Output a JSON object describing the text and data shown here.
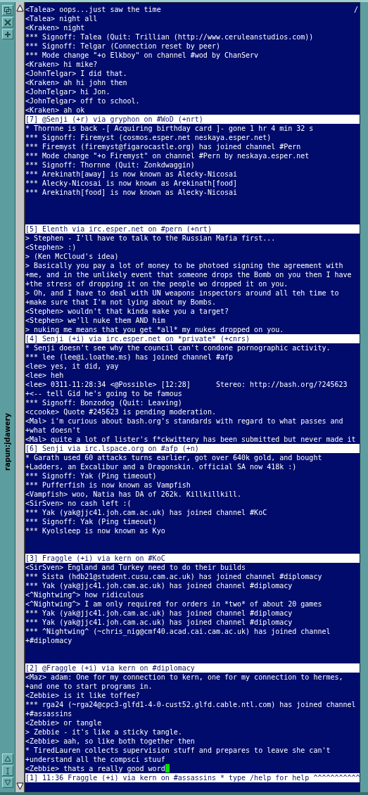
{
  "window": {
    "title": "rapun:jdawery",
    "corner_mark": "/"
  },
  "panes": [
    {
      "lines": [
        "<Talea> oops...just saw the time",
        "<Talea> night all",
        "<Kraken> night",
        "*** Signoff: Talea (Quit: Trillian (http://www.ceruleanstudios.com))",
        "*** Signoff: Telgar (Connection reset by peer)",
        "*** Mode change \"+o Elkboy\" on channel #wod by ChanServ",
        "<Kraken> hi mike?",
        "<JohnTelgar> I did that.",
        "<Kraken> ah hi john then",
        "<JohnTelgar> hi Jon.",
        "<JohnTelgar> off to school.",
        "<Kraken> ah ok"
      ],
      "status": "[7] @Senji (+r) via gryphon on #WoD (+nrt)"
    },
    {
      "lines": [
        "* Thornne is back -[ Acquiring birthday card ]- gone 1 hr 4 min 32 s",
        "*** Signoff: Firemyst (cosmos.esper.net neskaya.esper.net)",
        "*** Firemyst (firemyst@figarocastle.org) has joined channel #Pern",
        "*** Mode change \"+o Firemyst\" on channel #Pern by neskaya.esper.net",
        "*** Signoff: Thornne (Quit: Zonkdwaggin)",
        "*** Arekinath[away] is now known as Alecky-Nicosai",
        "*** Alecky-Nicosai is now known as Arekinath[food]",
        "*** Arekinath[food] is now known as Alecky-Nicosai"
      ],
      "status": "[5] Elenth via irc.esper.net on #pern (+nrt)"
    },
    {
      "lines": [
        "> Stephen - I'll have to talk to the Russian Mafia first...",
        "<Stephen> :)",
        "> (Ken McCloud's idea)",
        "> Basically you pay a lot of money to be photoed signing the agreement with",
        "+me, and in the unlikely event that someone drops the Bomb on you then I have",
        "+the stress of dropping it on the people wo dropped it on you.",
        "> Oh, and I have to deal with UN weapons inspectors around all teh time to",
        "+make sure that I'm not lying about my Bombs.",
        "<Stephen> wouldn't that kinda make you a target?",
        "<Stephen> we'll nuke them AND him",
        "> nuking me means that you get *all* my nukes dropped on you."
      ],
      "status": "[4] Senji (+i) via irc.esper.net on *private* (+cnrs)"
    },
    {
      "lines": [
        "* Senji doesn't see why the council can't condone pornographic activity.",
        "*** lee (lee@i.loathe.ms) has joined channel #afp",
        "<lee> yes, it did, yay",
        "<lee> heh",
        "<lee> 0311-11:28:34 <@Possible> [12:28]      Stereo: http://bash.org/?245623",
        "+<-- tell Gid he's going to be famous",
        "*** Signoff: Bonzodog (Quit: Leaving)",
        "<ccooke> Quote #245623 is pending moderation.",
        "<Mal> i'm curious about bash.org's standards with regard to what passes and",
        "+what doesn't",
        "<Mal> quite a lot of lister's f*ckwittery has been submitted but never made it"
      ],
      "status": "[6] Senji via irc.lspace.org on #afp (+n)"
    },
    {
      "lines": [
        "* Garath used 60 attacks turns earlier, got over 640k gold, and bought",
        "+Ladders, an Excalibur and a Dragonskin. official SA now 418k :)",
        "*** Signoff: Yak (Ping timeout)",
        "*** Pufferfish is now known as Vampfish",
        "<Vampfish> woo, Natia has DA of 262k. Killkillkill.",
        "<SirSven> no cash left :(",
        "*** Yak (yak@jjc41.joh.cam.ac.uk) has joined channel #KoC",
        "*** Signoff: Yak (Ping timeout)",
        "*** Kyolsleep is now known as Kyo"
      ],
      "status": "[3] Fraggle (+i) via kern on #KoC"
    },
    {
      "lines": [
        "<SirSven> England and Turkey need to do their builds",
        "*** Sista (hdb21@student.cusu.cam.ac.uk) has joined channel #diplomacy",
        "*** Yak (yak@jjc41.joh.cam.ac.uk) has joined channel #diplomacy",
        "<^Nightwing^> how ridiculous",
        "<^Nightwing^> I am only required for orders in *two* of about 20 games",
        "*** Yak (yak@jjc41.joh.cam.ac.uk) has joined channel #diplomacy",
        "*** Yak (yak@jjc41.joh.cam.ac.uk) has joined channel #diplomacy",
        "*** ^Nightwing^ (~chris_nig@cmf40.acad.cai.cam.ac.uk) has joined channel",
        "+#diplomacy"
      ],
      "status": "[2] @Fraggle (+i) via kern on #diplomacy"
    },
    {
      "lines": [
        "<Maz> adam: One for my connection to kern, one for my connection to hermes,",
        "+and one to start programs in.",
        "<Zebbie> is it like toffee?",
        "*** rga24 (~rga24@cpc3-glfd1-4-0-cust52.glfd.cable.ntl.com) has joined channel",
        "+#assassins",
        "<Zebbie> or tangle",
        "> Zebbie - it's like a sticky tangle.",
        "<Zebbie> aah, so like both together then",
        "* TiredLauren collects supervision stuff and prepares to leave she can't",
        "+understand all the compsci stuuf",
        "<Zebbie> thats a really good word"
      ],
      "status": "[1] 11:36 Fraggle (+i) via kern on #assassins * type /help for help ^^^^^^^^^^^",
      "cursor": true
    }
  ]
}
